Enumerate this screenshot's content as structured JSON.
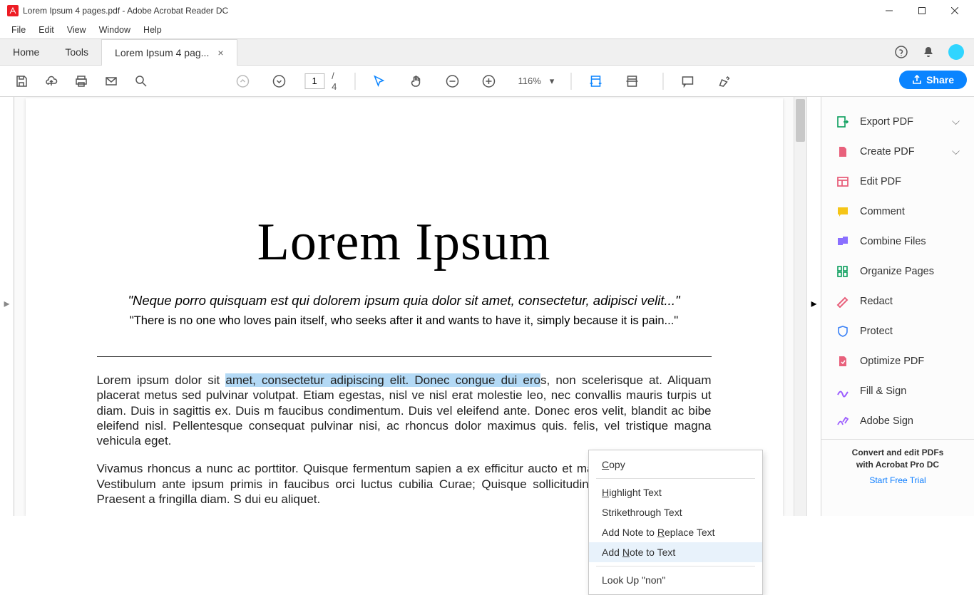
{
  "window": {
    "title": "Lorem Ipsum 4 pages.pdf - Adobe Acrobat Reader DC"
  },
  "menubar": {
    "items": [
      "File",
      "Edit",
      "View",
      "Window",
      "Help"
    ]
  },
  "tabs": {
    "home": "Home",
    "tools": "Tools",
    "doc": "Lorem Ipsum 4 pag..."
  },
  "toolbar": {
    "page_current": "1",
    "page_separator": "/",
    "page_total": "4",
    "zoom": "116%",
    "share_label": "Share"
  },
  "document": {
    "heading": "Lorem Ipsum",
    "quote_latin": "\"Neque porro quisquam est qui dolorem ipsum quia dolor sit amet, consectetur, adipisci velit...\"",
    "quote_en": "\"There is no one who loves pain itself, who seeks after it and wants to have it, simply because it is pain...\"",
    "para1_pre": "Lorem ipsum dolor sit ",
    "para1_highlight": "amet, consectetur adipiscing elit. Donec congue dui ero",
    "para1_post": "s, non scelerisque at. Aliquam placerat metus sed pulvinar volutpat. Etiam egestas, nisl ve nisl erat molestie leo, nec convallis mauris turpis ut diam. Duis in sagittis ex. Duis m faucibus condimentum. Duis vel eleifend ante. Donec eros velit, blandit ac bibe eleifend nisl. Pellentesque consequat pulvinar nisi, ac rhoncus dolor maximus quis. felis, vel tristique magna vehicula eget.",
    "para2": "Vivamus rhoncus a nunc ac porttitor. Quisque fermentum sapien a ex efficitur aucto et mauris volutpat rhoncus. Vestibulum ante ipsum primis in faucibus orci luctus cubilia Curae; Quisque sollicitudin pellentesque efficitur. Praesent a fringilla diam. S dui eu aliquet."
  },
  "context_menu": {
    "copy": "Copy",
    "highlight": "Highlight Text",
    "strikethrough": "Strikethrough Text",
    "add_note_replace": "Add Note to Replace Text",
    "add_note_text": "Add Note to Text",
    "lookup": "Look Up \"non\""
  },
  "right_panel": {
    "items": [
      {
        "label": "Export PDF",
        "expandable": true
      },
      {
        "label": "Create PDF",
        "expandable": true
      },
      {
        "label": "Edit PDF"
      },
      {
        "label": "Comment"
      },
      {
        "label": "Combine Files"
      },
      {
        "label": "Organize Pages"
      },
      {
        "label": "Redact"
      },
      {
        "label": "Protect"
      },
      {
        "label": "Optimize PDF"
      },
      {
        "label": "Fill & Sign"
      },
      {
        "label": "Adobe Sign"
      }
    ],
    "footer_line1": "Convert and edit PDFs",
    "footer_line2": "with Acrobat Pro DC",
    "footer_link": "Start Free Trial"
  }
}
